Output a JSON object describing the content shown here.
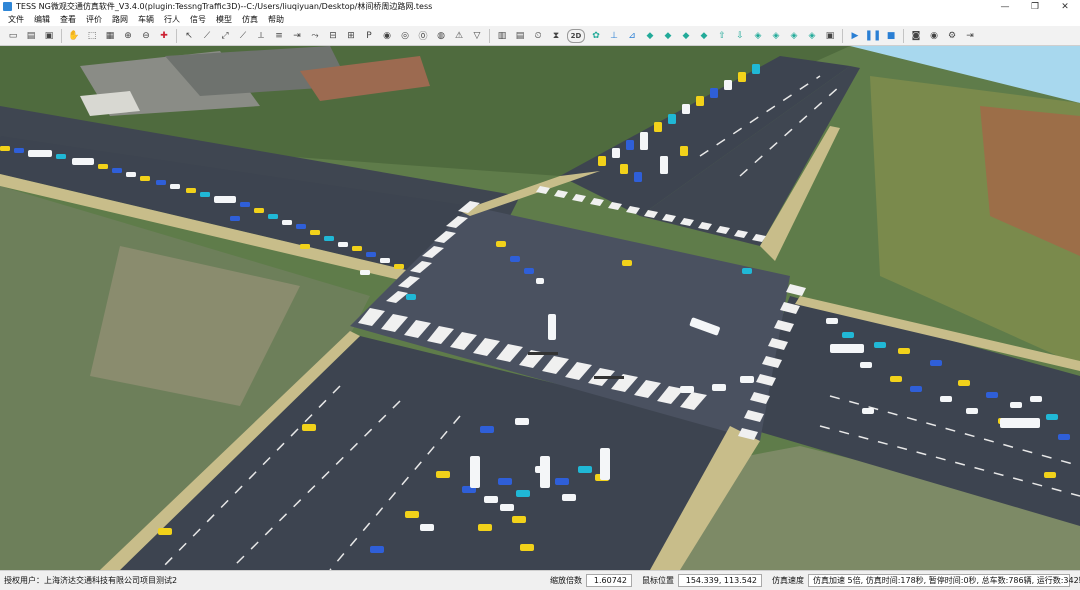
{
  "window": {
    "title": "TESS NG微观交通仿真软件_V3.4.0(plugin:TessngTraffic3D)--C:/Users/liuqiyuan/Desktop/林间桥周边路网.tess",
    "minimize_glyph": "—",
    "restore_glyph": "❐",
    "close_glyph": "✕"
  },
  "menu": {
    "items": [
      "文件",
      "编辑",
      "查看",
      "评价",
      "路网",
      "车辆",
      "行人",
      "信号",
      "模型",
      "仿真",
      "帮助"
    ]
  },
  "toolbar": {
    "view_2d_label": "2D",
    "icons": [
      "new-file-icon",
      "open-file-icon",
      "save-icon",
      "hand-icon",
      "zoom-window-icon",
      "grid-icon",
      "zoom-in-icon",
      "zoom-out-icon",
      "fit-view-icon",
      "select-icon",
      "draw-road-icon",
      "draw-connector-icon",
      "edit-road-icon",
      "split-road-icon",
      "edit-lane-icon",
      "vehicle-input-icon",
      "routing-icon",
      "bus-line-icon",
      "bus-stop-icon",
      "parking-icon",
      "signal-icon",
      "detector-icon",
      "speed-limit-icon",
      "reduce-speed-icon",
      "warning-icon",
      "yield-icon",
      "priority-icon",
      "queue-icon",
      "travel-time-icon",
      "scale-icon"
    ]
  },
  "colors": {
    "vehicle_yellow": "#f2d21a",
    "vehicle_blue": "#2f5fd8",
    "vehicle_cyan": "#20b8d6",
    "vehicle_white": "#f4f6f8",
    "road_asphalt": "#3d4450",
    "road_edge": "#c8bd8a",
    "accent": "#2a7fd4"
  },
  "status": {
    "user_label": "授权用户：上海济达交通科技有限公司项目测试2",
    "zoom_label": "缩放倍数",
    "zoom_value": "1.60742",
    "mouse_label": "鼠标位置",
    "mouse_value": "154.339, 113.542",
    "speed_label": "仿真速度",
    "sim_info": "仿真加速 5倍, 仿真时间:178秒, 暂停时间:0秒, 总车数:786辆, 运行数:342辆"
  }
}
